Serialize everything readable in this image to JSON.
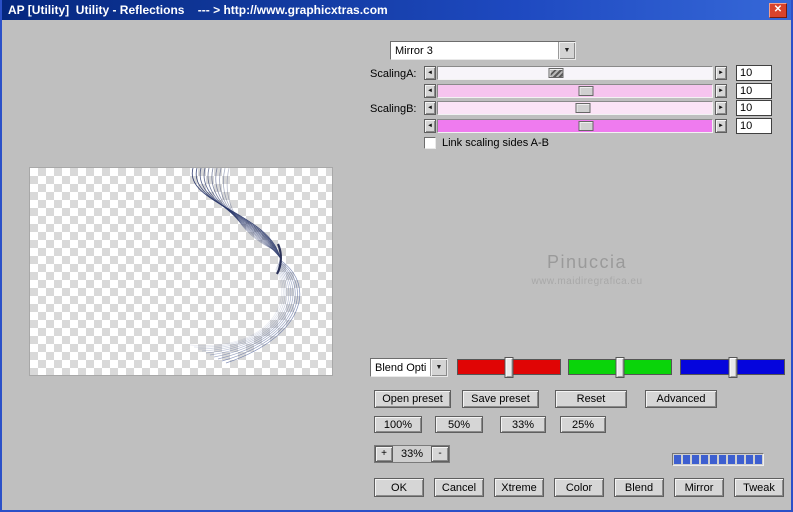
{
  "window": {
    "title": "AP [Utility]  Utility - Reflections    --- > http://www.graphicxtras.com"
  },
  "icons": {
    "close": "✕",
    "dropdown": "▼",
    "arrow_left": "◄",
    "arrow_right": "►"
  },
  "colors": {
    "titlebar": "#1e49c0",
    "red_slider": "#e00505",
    "green_slider": "#0ad40a",
    "blue_slider": "#0505dd",
    "progress_segment": "#3d5fd0",
    "track_row1": "#f7f5fa",
    "track_row2": "#f6c4ee",
    "track_row3": "#fbe4f6",
    "track_row4": "#ef7bef"
  },
  "mirror_select": {
    "value": "Mirror 3"
  },
  "scaling": {
    "label_a": "ScalingA:",
    "label_b": "ScalingB:",
    "rows": [
      {
        "value": "10"
      },
      {
        "value": "10"
      },
      {
        "value": "10"
      },
      {
        "value": "10"
      }
    ],
    "link_label": "Link scaling sides A-B",
    "link_checked": false
  },
  "watermark": {
    "line1": "Pinuccia",
    "line2": "www.maidiregrafica.eu"
  },
  "blend_select": {
    "value": "Blend Opti"
  },
  "presets": {
    "buttons": [
      {
        "label": "Open preset"
      },
      {
        "label": "Save preset"
      },
      {
        "label": "Reset"
      },
      {
        "label": "Advanced"
      }
    ]
  },
  "zoom": {
    "buttons": [
      {
        "label": "100%"
      },
      {
        "label": "50%"
      },
      {
        "label": "33%"
      },
      {
        "label": "25%"
      }
    ],
    "stepper": {
      "plus": "+",
      "value": "33%",
      "minus": "-"
    }
  },
  "progress": {
    "segments": 10
  },
  "actions": {
    "buttons": [
      {
        "label": "OK"
      },
      {
        "label": "Cancel"
      },
      {
        "label": "Xtreme"
      },
      {
        "label": "Color"
      },
      {
        "label": "Blend"
      },
      {
        "label": "Mirror"
      },
      {
        "label": "Tweak"
      }
    ]
  }
}
